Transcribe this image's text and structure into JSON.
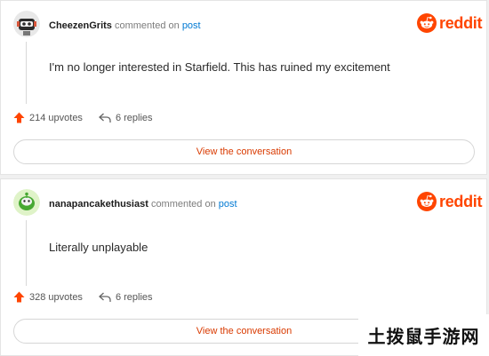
{
  "comments": [
    {
      "username": "CheezenGrits",
      "action_text": "commented on",
      "post_link": "post",
      "text": "I'm no longer interested in Starfield. This has ruined my excitement",
      "upvotes": "214 upvotes",
      "replies": "6 replies",
      "button_label": "View the conversation",
      "avatar_icon": "robot-avatar-icon"
    },
    {
      "username": "nanapancakethusiast",
      "action_text": "commented on",
      "post_link": "post",
      "text": "Literally unplayable",
      "upvotes": "328 upvotes",
      "replies": "6 replies",
      "button_label": "View the conversation",
      "avatar_icon": "green-snoo-avatar-icon"
    }
  ],
  "brand": {
    "wordmark": "reddit",
    "color": "#ff4500"
  },
  "colors": {
    "link": "#0079d3",
    "upvote": "#ff4500",
    "button_text": "#d93a00"
  },
  "watermark": {
    "text": "土拨鼠手游网"
  }
}
